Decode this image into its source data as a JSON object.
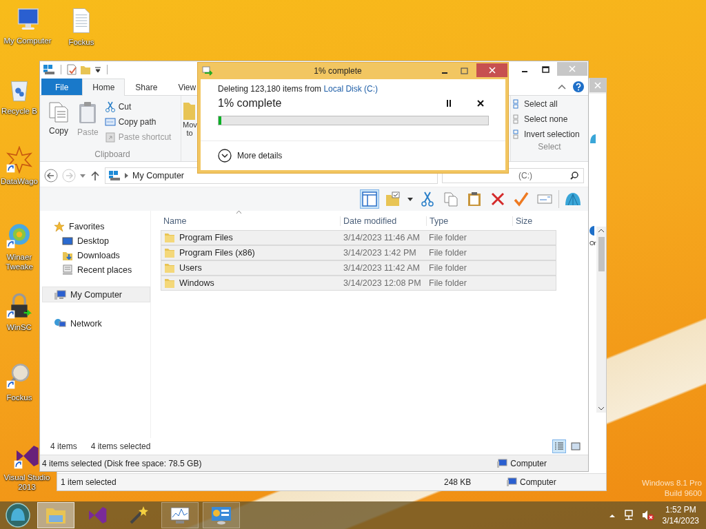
{
  "desktop": {
    "icons": [
      {
        "kind": "computer",
        "label": "My Computer",
        "shortcut": false
      },
      {
        "kind": "document",
        "label": "Fockus",
        "shortcut": false
      },
      {
        "kind": "recycle-bin",
        "label": "Recycle B",
        "shortcut": false
      },
      {
        "kind": "star-logo",
        "label": "DataWago",
        "shortcut": true
      },
      {
        "kind": "swirl",
        "label": "Winaer Tweake",
        "shortcut": true
      },
      {
        "kind": "padlock",
        "label": "WinSC",
        "shortcut": true
      },
      {
        "kind": "magnifier",
        "label": "Fockus",
        "shortcut": true
      },
      {
        "kind": "vs-logo",
        "label": "Visual Studio 2013",
        "shortcut": true
      }
    ],
    "edition": [
      "Windows 8.1 Pro",
      "Build 9600"
    ]
  },
  "back_window": {
    "partial_label": "Or",
    "status_bar": {
      "selection": "1 item selected",
      "size": "248 KB",
      "location": "Computer"
    }
  },
  "explorer": {
    "tabs": [
      {
        "label": "File",
        "kind": "file",
        "selected": false
      },
      {
        "label": "Home",
        "kind": "tab",
        "selected": true
      },
      {
        "label": "Share",
        "kind": "tab",
        "selected": false
      },
      {
        "label": "View",
        "kind": "tab",
        "selected": false
      }
    ],
    "clipboard": {
      "large": [
        {
          "kind": "copy",
          "label": "Copy",
          "disabled": false
        },
        {
          "kind": "paste",
          "label": "Paste",
          "disabled": true
        }
      ],
      "small": [
        {
          "kind": "cut",
          "label": "Cut",
          "disabled": false
        },
        {
          "kind": "copy-path",
          "label": "Copy path",
          "disabled": false
        },
        {
          "kind": "paste-shortcut",
          "label": "Paste shortcut",
          "disabled": true
        }
      ],
      "group": "Clipboard"
    },
    "organize": {
      "label": "Mov to"
    },
    "select": {
      "items": [
        {
          "kind": "select-all",
          "label": "Select all"
        },
        {
          "kind": "select-none",
          "label": "Select none"
        },
        {
          "kind": "invert",
          "label": "Invert selection"
        }
      ],
      "group": "Select"
    },
    "address": {
      "path": "My Computer"
    },
    "search": {
      "placeholder": "(C:)"
    },
    "toolbar": [
      {
        "kind": "layout",
        "selected": true
      },
      {
        "kind": "folder-check",
        "selected": false
      },
      {
        "kind": "caret",
        "selected": false
      },
      {
        "kind": "cut",
        "selected": false
      },
      {
        "kind": "copy",
        "selected": false
      },
      {
        "kind": "paste",
        "selected": false
      },
      {
        "kind": "delete",
        "selected": false
      },
      {
        "kind": "check",
        "selected": false
      },
      {
        "kind": "card",
        "selected": false
      },
      {
        "kind": "shell",
        "selected": false
      }
    ],
    "nav": [
      {
        "kind": "star",
        "label": "Favorites",
        "selected": false,
        "children": [
          {
            "kind": "desktop",
            "label": "Desktop",
            "selected": false
          },
          {
            "kind": "downloads",
            "label": "Downloads",
            "selected": false
          },
          {
            "kind": "recent",
            "label": "Recent places",
            "selected": false
          }
        ]
      },
      {
        "kind": "computer",
        "label": "My Computer",
        "selected": true
      },
      {
        "kind": "network",
        "label": "Network",
        "selected": false
      }
    ],
    "columns": [
      "Name",
      "Date modified",
      "Type",
      "Size"
    ],
    "rows": [
      {
        "name": "Program Files",
        "date": "3/14/2023 11:46 AM",
        "type": "File folder",
        "selected": true
      },
      {
        "name": "Program Files (x86)",
        "date": "3/14/2023 1:42 PM",
        "type": "File folder",
        "selected": true
      },
      {
        "name": "Users",
        "date": "3/14/2023 11:42 AM",
        "type": "File folder",
        "selected": true
      },
      {
        "name": "Windows",
        "date": "3/14/2023 12:08 PM",
        "type": "File folder",
        "selected": true
      }
    ],
    "item_count": "4 items",
    "selection_count": "4 items selected",
    "views": [
      {
        "kind": "details",
        "selected": true
      },
      {
        "kind": "large-icons",
        "selected": false
      }
    ],
    "status_bar": {
      "text": "4 items selected (Disk free space: 78.5 GB)",
      "location": "Computer"
    }
  },
  "dialog": {
    "title": "1% complete",
    "message": "Deleting 123,180 items from",
    "source": "Local Disk (C:)",
    "heading": "1% complete",
    "level": 0.01,
    "details": "More details"
  },
  "taskbar": {
    "items": [
      {
        "kind": "start",
        "selected": false,
        "running": false
      },
      {
        "kind": "explorer",
        "selected": true,
        "running": true
      },
      {
        "kind": "visual-studio",
        "selected": false,
        "running": false
      },
      {
        "kind": "wand",
        "selected": false,
        "running": false
      },
      {
        "kind": "monitor",
        "selected": false,
        "running": true
      },
      {
        "kind": "control-panel",
        "selected": false,
        "running": true
      }
    ],
    "tray": [
      {
        "kind": "caret",
        "muted": false
      },
      {
        "kind": "network",
        "muted": false
      },
      {
        "kind": "volume",
        "muted": true
      }
    ],
    "time": "1:52 PM",
    "date": "3/14/2023"
  }
}
